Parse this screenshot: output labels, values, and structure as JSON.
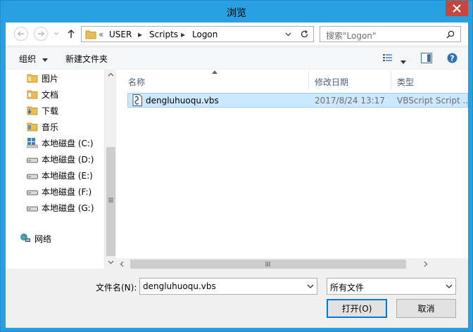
{
  "window": {
    "title": "浏览"
  },
  "nav": {
    "address": [
      "USER",
      "Scripts",
      "Logon"
    ],
    "search_placeholder": "搜索\"Logon\""
  },
  "commands": {
    "organize": "组织",
    "new_folder": "新建文件夹"
  },
  "sidebar": {
    "items": [
      {
        "label": "图片",
        "icon": "pictures-folder-icon"
      },
      {
        "label": "文档",
        "icon": "documents-folder-icon"
      },
      {
        "label": "下载",
        "icon": "downloads-folder-icon"
      },
      {
        "label": "音乐",
        "icon": "music-folder-icon"
      },
      {
        "label": "本地磁盘 (C:)",
        "icon": "system-drive-icon"
      },
      {
        "label": "本地磁盘 (D:)",
        "icon": "drive-icon"
      },
      {
        "label": "本地磁盘 (E:)",
        "icon": "drive-icon"
      },
      {
        "label": "本地磁盘 (F:)",
        "icon": "drive-icon"
      },
      {
        "label": "本地磁盘 (G:)",
        "icon": "drive-icon"
      }
    ],
    "network": "网络"
  },
  "file_list": {
    "columns": [
      "名称",
      "修改日期",
      "类型"
    ],
    "rows": [
      {
        "name": "dengluhuoqu.vbs",
        "modified": "2017/8/24 13:17",
        "type": "VBScript Script ..."
      }
    ]
  },
  "footer": {
    "filename_label": "文件名(N):",
    "filename_value": "dengluhuoqu.vbs",
    "filter_value": "所有文件",
    "open_label": "打开(O)",
    "cancel_label": "取消"
  },
  "colors": {
    "title_bar": "#28a0e0",
    "close": "#c7463c",
    "selection": "#cce8ff",
    "default_button_border": "#0078d7"
  }
}
